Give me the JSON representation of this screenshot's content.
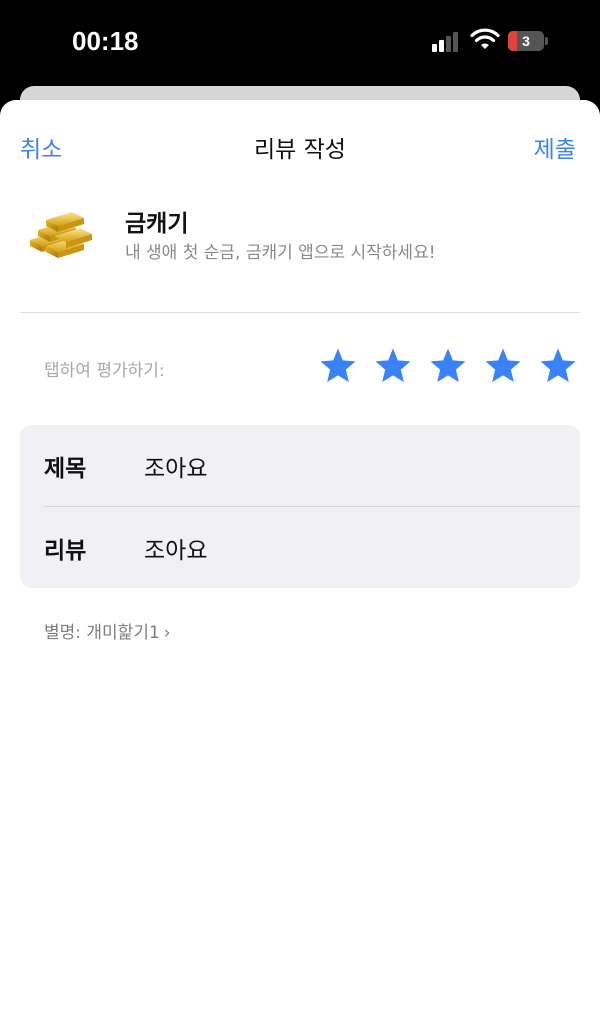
{
  "status_bar": {
    "time": "00:18",
    "battery_level": "3",
    "icons": [
      "signal-icon",
      "wifi-icon",
      "battery-icon"
    ]
  },
  "nav": {
    "cancel_label": "취소",
    "title": "리뷰 작성",
    "submit_label": "제출"
  },
  "app": {
    "icon": "gold-bars-icon",
    "name": "금캐기",
    "subtitle": "내 생애 첫 순금, 금캐기 앱으로 시작하세요!"
  },
  "rating": {
    "prompt": "탭하여 평가하기:",
    "value": 5,
    "max": 5,
    "color": "#3a82f7"
  },
  "form": {
    "title_label": "제목",
    "title_value": "조아요",
    "review_label": "리뷰",
    "review_value": "조아요"
  },
  "nickname": {
    "text": "별명: 개미핥기1",
    "chevron": "›"
  },
  "colors": {
    "accent": "#3a82f7",
    "background": "#000000",
    "sheet": "#ffffff",
    "field_bg": "#f0f0f5"
  }
}
